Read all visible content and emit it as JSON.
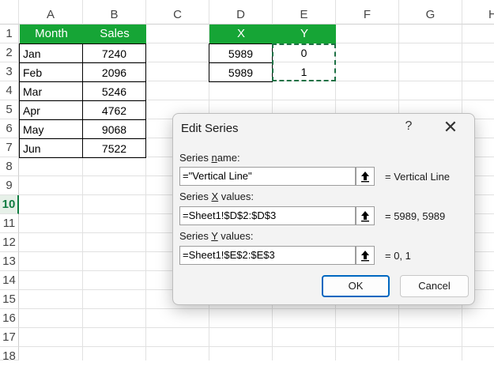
{
  "columns": [
    "A",
    "B",
    "C",
    "D",
    "E",
    "F",
    "G",
    "H"
  ],
  "rows": [
    "1",
    "2",
    "3",
    "4",
    "5",
    "6",
    "7",
    "8",
    "9",
    "10",
    "11",
    "12",
    "13",
    "14",
    "15",
    "16",
    "17",
    "18"
  ],
  "active_row": "10",
  "table1": {
    "headers": [
      "Month",
      "Sales"
    ],
    "rows": [
      [
        "Jan",
        "7240"
      ],
      [
        "Feb",
        "2096"
      ],
      [
        "Mar",
        "5246"
      ],
      [
        "Apr",
        "4762"
      ],
      [
        "May",
        "9068"
      ],
      [
        "Jun",
        "7522"
      ]
    ]
  },
  "table2": {
    "headers": [
      "X",
      "Y"
    ],
    "rows": [
      [
        "5989",
        "0"
      ],
      [
        "5989",
        "1"
      ]
    ]
  },
  "colors": {
    "header_green": "#16a536",
    "marquee": "#1e7145",
    "accent": "#0067c0"
  },
  "dialog": {
    "title": "Edit Series",
    "help": "?",
    "close": "✕",
    "series_name": {
      "label_pre": "Series ",
      "label_key": "n",
      "label_post": "ame:",
      "value": "=\"Vertical Line\"",
      "result": "= Vertical Line"
    },
    "series_x": {
      "label_pre": "Series ",
      "label_key": "X",
      "label_post": " values:",
      "value": "=Sheet1!$D$2:$D$3",
      "result": "= 5989, 5989"
    },
    "series_y": {
      "label_pre": "Series ",
      "label_key": "Y",
      "label_post": " values:",
      "value": "=Sheet1!$E$2:$E$3",
      "result": "= 0, 1"
    },
    "ok_label": "OK",
    "cancel_label": "Cancel",
    "picker_icon": "range-select-icon"
  }
}
